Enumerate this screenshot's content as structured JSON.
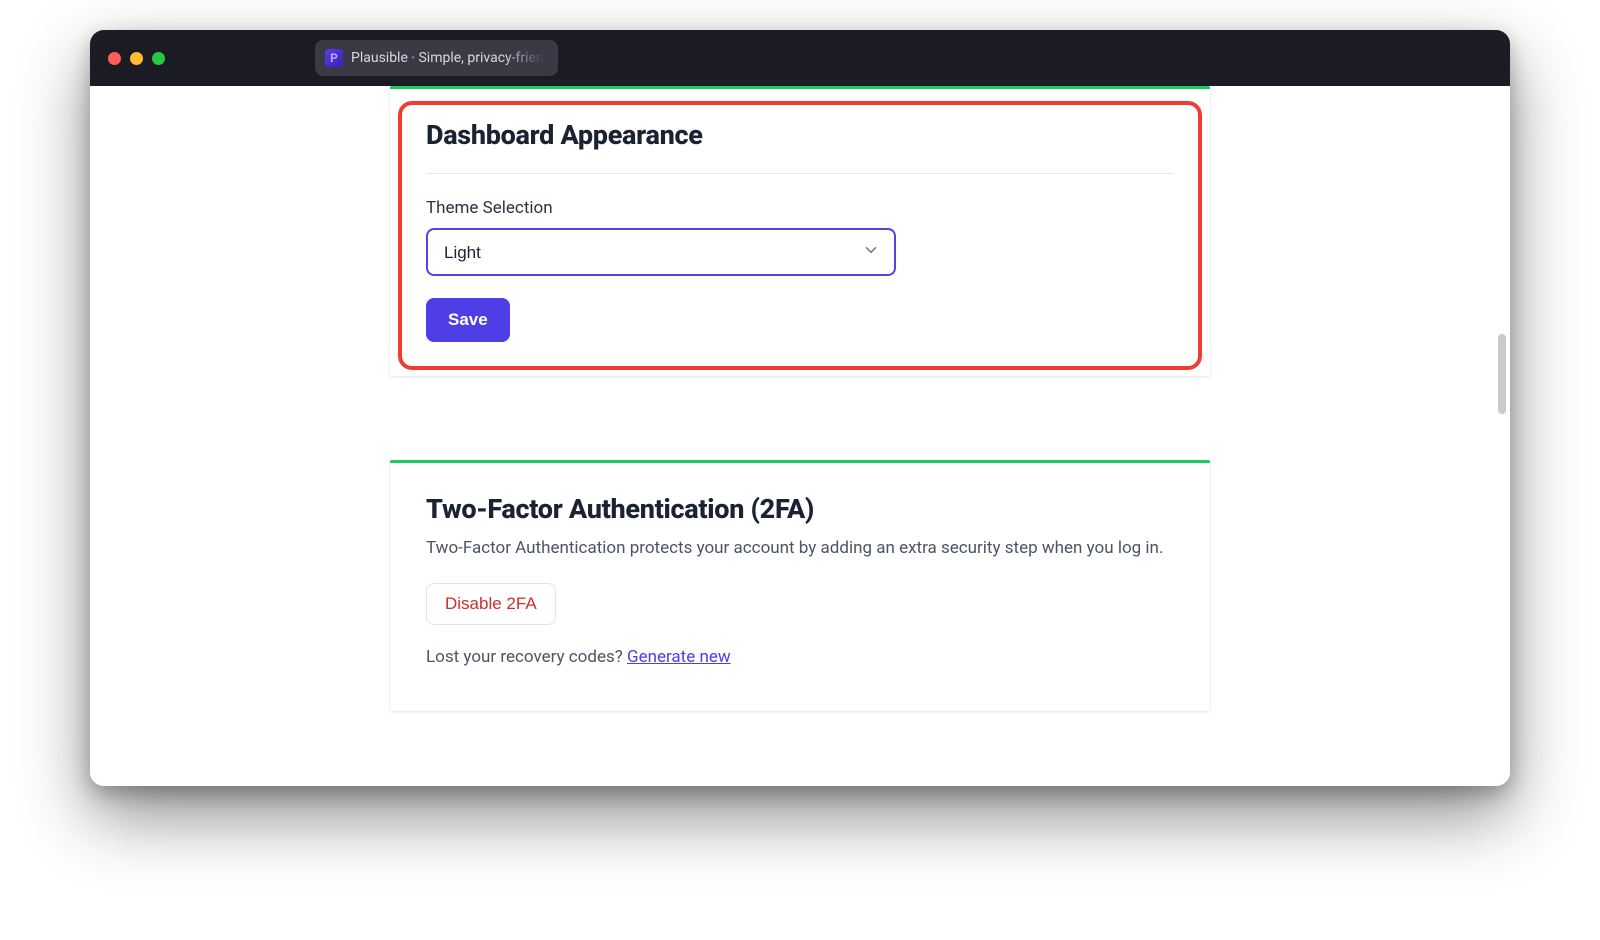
{
  "window": {
    "tab_title": "Plausible · Simple, privacy-frien",
    "favicon_letter": "P"
  },
  "appearance": {
    "heading": "Dashboard Appearance",
    "theme_label": "Theme Selection",
    "theme_value": "Light",
    "save_label": "Save"
  },
  "twofa": {
    "heading": "Two-Factor Authentication (2FA)",
    "description": "Two-Factor Authentication protects your account by adding an extra security step when you log in.",
    "disable_label": "Disable 2FA",
    "lost_prefix": "Lost your recovery codes? ",
    "generate_link": "Generate new"
  },
  "colors": {
    "accent": "#4f3ee6",
    "success": "#18c964",
    "danger": "#d22c2c",
    "highlight_box": "#f03d2f"
  }
}
